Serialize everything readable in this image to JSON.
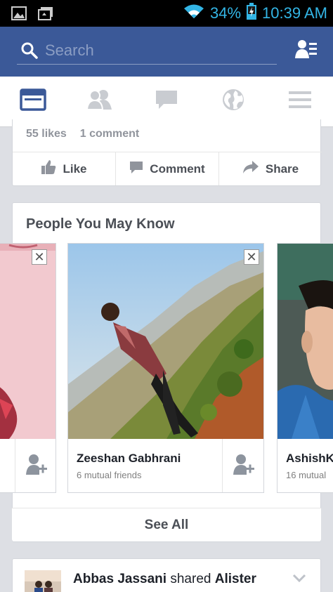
{
  "status_bar": {
    "battery_percent": "34%",
    "time": "10:39 AM",
    "icons": [
      "gallery-icon",
      "photo-upload-icon",
      "wifi-icon",
      "battery-icon"
    ]
  },
  "search": {
    "placeholder": "Search"
  },
  "nav": {
    "tabs": [
      "news-feed-icon",
      "friend-requests-icon",
      "messages-icon",
      "notifications-globe-icon",
      "menu-icon"
    ]
  },
  "post": {
    "likes": "55 likes",
    "comments": "1 comment",
    "actions": {
      "like": "Like",
      "comment": "Comment",
      "share": "Share"
    }
  },
  "pymk": {
    "title": "People You May Know",
    "people": [
      {
        "name": "",
        "mutual": ""
      },
      {
        "name": "Zeeshan Gabhrani",
        "mutual": "6 mutual friends"
      },
      {
        "name": "AshishKu",
        "mutual": "16 mutual"
      }
    ],
    "see_all": "See All"
  },
  "feed": {
    "author": "Abbas Jassani",
    "verb": " shared ",
    "target": "Alister"
  },
  "colors": {
    "brand": "#3b5998",
    "status_blue": "#33b5e5"
  }
}
